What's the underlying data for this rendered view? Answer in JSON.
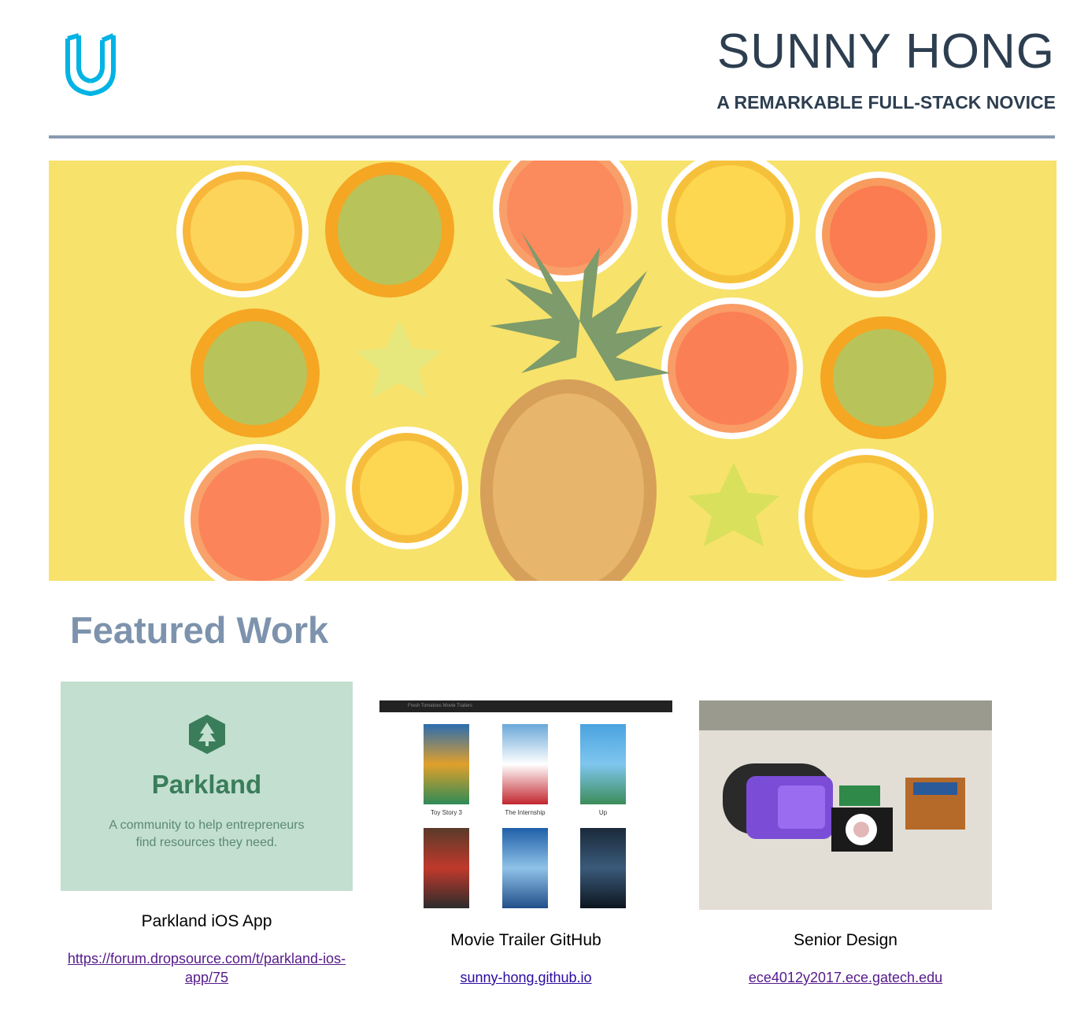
{
  "header": {
    "logo_icon": "udacity-logo-icon",
    "name": "SUNNY HONG",
    "tagline": "A REMARKABLE FULL-STACK NOVICE"
  },
  "hero": {
    "image": "fruit-banner-image"
  },
  "featured": {
    "title": "Featured Work",
    "items": [
      {
        "title": "Parkland iOS App",
        "link": "https://forum.dropsource.com/t/parkland-ios-app/75",
        "link_line1": "https://forum.dropsource.com/t/parkland-ios-",
        "link_line2": "app/75",
        "thumb": {
          "brand": "Parkland",
          "desc_line1": "A community to help entrepreneurs",
          "desc_line2": "find resources they need."
        }
      },
      {
        "title": "Movie Trailer GitHub",
        "link": "sunny-hong.github.io",
        "thumb": {
          "bar_title": "Fresh Tomatoes Movie Trailers",
          "movies": [
            "Toy Story 3",
            "The Internship",
            "Up",
            "",
            "",
            ""
          ]
        }
      },
      {
        "title": "Senior Design",
        "link": "ece4012y2017.ece.gatech.edu"
      }
    ]
  },
  "colors": {
    "name": "#2d3e50",
    "section_title": "#7d93ad",
    "divider": "#8a9bb0",
    "logo": "#02b3e4",
    "parkland_bg": "#c3dfcf",
    "parkland_green": "#3a7d5a"
  }
}
